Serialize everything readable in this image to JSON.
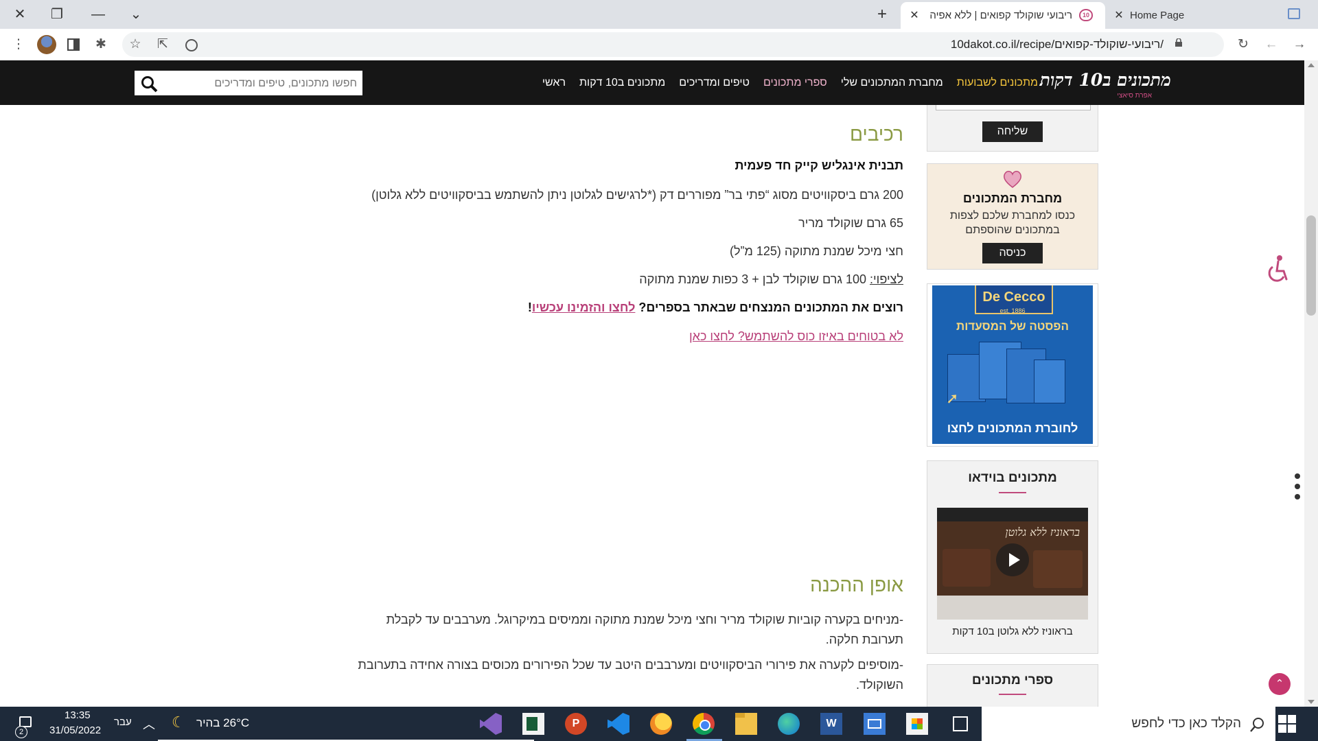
{
  "browser": {
    "tabs": [
      {
        "title": "ריבועי שוקולד קפואים | ללא אפיה",
        "active": true
      },
      {
        "title": "Home Page",
        "active": false
      }
    ],
    "url": "10dakot.co.il/recipe/ריבועי-שוקולד-קפואים/"
  },
  "site": {
    "logo_text": "מתכונים ב10 דקות",
    "logo_sub": "אפרת סיאצי",
    "nav": [
      "ראשי",
      "מתכונים ב10 דקות",
      "טיפים ומדריכים",
      "ספרי מתכונים",
      "מחברת המתכונים שלי",
      "מתכונים לשבועות"
    ],
    "search_placeholder": "חפשו מתכונים, טיפים ומדריכים"
  },
  "article": {
    "ingredients_heading": "רכיבים",
    "pan": "תבנית אינגליש קייק חד פעמית",
    "ingredients": [
      "200 גרם ביסקוויטים מסוג “פתי בר” מפוררים דק (*לרגישים לגלוטן ניתן להשתמש בביסקוויטים ללא גלוטן)",
      "65 גרם שוקולד מריר",
      "חצי מיכל שמנת מתוקה (125 מ”ל)"
    ],
    "coating_label": "לציפוי:",
    "coating_text": " 100 גרם שוקולד לבן + 3 כפות שמנת מתוקה",
    "promo_question": "רוצים את המתכונים המנצחים שבאתר בספרים? ",
    "promo_link": "לחצו והזמינו עכשיו",
    "promo_end": "!",
    "cup_link": "לא בטוחים באיזו כוס להשתמש? לחצו כאן",
    "prep_heading": "אופן ההכנה",
    "steps": [
      "-מניחים בקערה קוביות שוקולד מריר וחצי מיכל שמנת מתוקה וממיסים במיקרוגל. מערבבים עד לקבלת תערובת חלקה.",
      "-מוסיפים לקערה את פירורי הביסקוויטים ומערבבים היטב עד שכל הפירורים מכוסים בצורה אחידה בתערובת השוקולד."
    ]
  },
  "sidebar": {
    "send_button": "שליחה",
    "notebook": {
      "title": "מחברת המתכונים",
      "text": "כנסו למחברת שלכם לצפות במתכונים שהוספתם",
      "button": "כניסה"
    },
    "ad": {
      "brand": "De Cecco",
      "est": "est. 1886",
      "headline": "הפסטה של המסעדות",
      "cta": "לחוברת המתכונים לחצו"
    },
    "video": {
      "title": "מתכונים בוידאו",
      "thumb_text": "בראוניז ללא גלוטן",
      "caption": "בראוניז ללא גלוטן ב10 דקות"
    },
    "books": {
      "title": "ספרי מתכונים"
    }
  },
  "taskbar": {
    "search_placeholder": "הקלד כאן כדי לחפש",
    "weather": "26°C  בהיר",
    "language": "עבר",
    "time": "13:35",
    "date": "31/05/2022",
    "notifications": "2"
  },
  "colors": {
    "accent_pink": "#c04a7c",
    "heading_green": "#8a9a43",
    "header_bg": "#161616",
    "gold": "#f4c53c"
  }
}
